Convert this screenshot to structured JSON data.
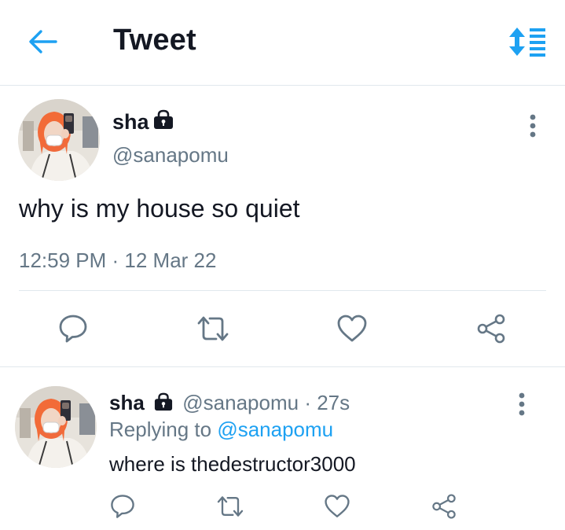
{
  "header": {
    "title": "Tweet",
    "back_icon": "arrow-left-icon",
    "sort_icon": "sort-list-icon",
    "accent_color": "#1da1f2"
  },
  "tweet": {
    "author_name": "sha",
    "protected_icon": "lock-icon",
    "handle": "@sanapomu",
    "text": "why is my house so quiet",
    "timestamp": "12:59 PM · 12 Mar 22",
    "actions": [
      "reply-icon",
      "retweet-icon",
      "like-icon",
      "share-icon"
    ]
  },
  "reply": {
    "author_name": "sha",
    "handle": "@sanapomu",
    "separator": " · ",
    "time": "27s",
    "replying_to_label": "Replying to",
    "replying_to_handle": "@sanapomu",
    "text": "where is thedestructor3000",
    "actions": [
      "reply-icon",
      "retweet-icon",
      "like-icon",
      "share-icon"
    ]
  },
  "colors": {
    "text_primary": "#141823",
    "text_secondary": "#657786",
    "link": "#1da1f2",
    "divider": "#e1e8ed"
  }
}
